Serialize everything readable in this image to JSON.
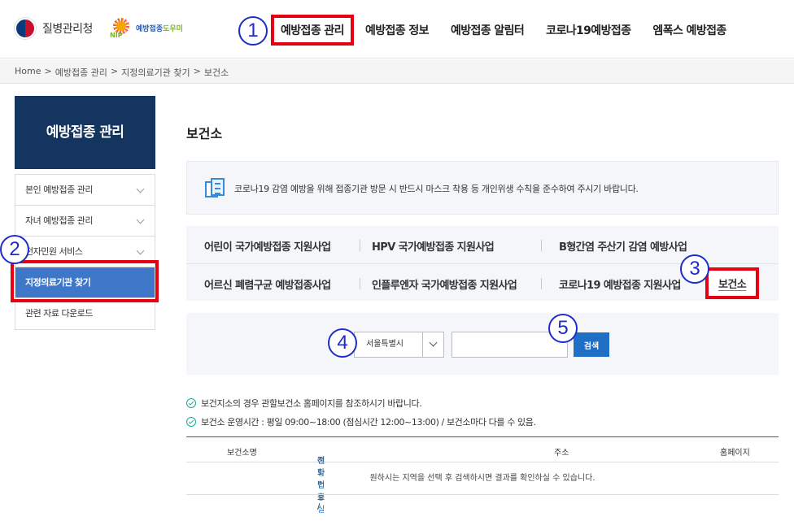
{
  "header": {
    "logo_text": "질병관리청",
    "logo2_text_a": "예방접종",
    "logo2_text_b": "도우미",
    "logo2_nip": "NIP",
    "nav": [
      "예방접종 관리",
      "예방접종 정보",
      "예방접종 알림터",
      "코로나19예방접종",
      "엠폭스 예방접종"
    ]
  },
  "callouts": [
    "1",
    "2",
    "3",
    "4",
    "5"
  ],
  "breadcrumb": [
    "Home",
    ">",
    "예방접종 관리",
    ">",
    "지정의료기관 찾기",
    ">",
    "보건소"
  ],
  "sidebar": {
    "title": "예방접종 관리",
    "items": [
      {
        "label": "본인 예방접종 관리"
      },
      {
        "label": "자녀 예방접종 관리"
      },
      {
        "label": "전자민원 서비스"
      },
      {
        "label": "지정의료기관 찾기"
      },
      {
        "label": "관련 자료 다운로드"
      }
    ]
  },
  "main": {
    "title": "보건소",
    "notice": "코로나19 감염 예방을 위해 접종기관 방문 시 반드시 마스크 착용 등 개인위생 수칙을 준수하여 주시기 바랍니다.",
    "tabs": [
      "어린이 국가예방접종 지원사업",
      "HPV 국가예방접종 지원사업",
      "B형간염 주산기 감염 예방사업",
      "어르신 폐렴구균 예방접종사업",
      "인플루엔자 국가예방접종 지원사업",
      "코로나19 예방접종 지원사업",
      "보건소"
    ],
    "search": {
      "region": "서울특별시",
      "input_value": "",
      "button": "검색"
    },
    "info": [
      "보건지소의 경우 관할보건소 홈페이지를 참조하시기 바랍니다.",
      "보건소 운영시간 : 평일 09:00~18:00 (점심시간 12:00~13:00) / 보건소마다 다를 수 있음."
    ],
    "table": {
      "headers": [
        "보건소명",
        "전화번호 / ",
        "예방접종실",
        "주소",
        "홈페이지"
      ],
      "empty_message": "원하시는 지역을 선택 후 검색하시면 결과를 확인하실 수 있습니다."
    }
  },
  "colors": {
    "highlight": "#e60012",
    "callout": "#1f2ccc",
    "side_title_bg": "#13355f",
    "side_active_bg": "#3f77c8",
    "search_button": "#1f6fc6"
  }
}
